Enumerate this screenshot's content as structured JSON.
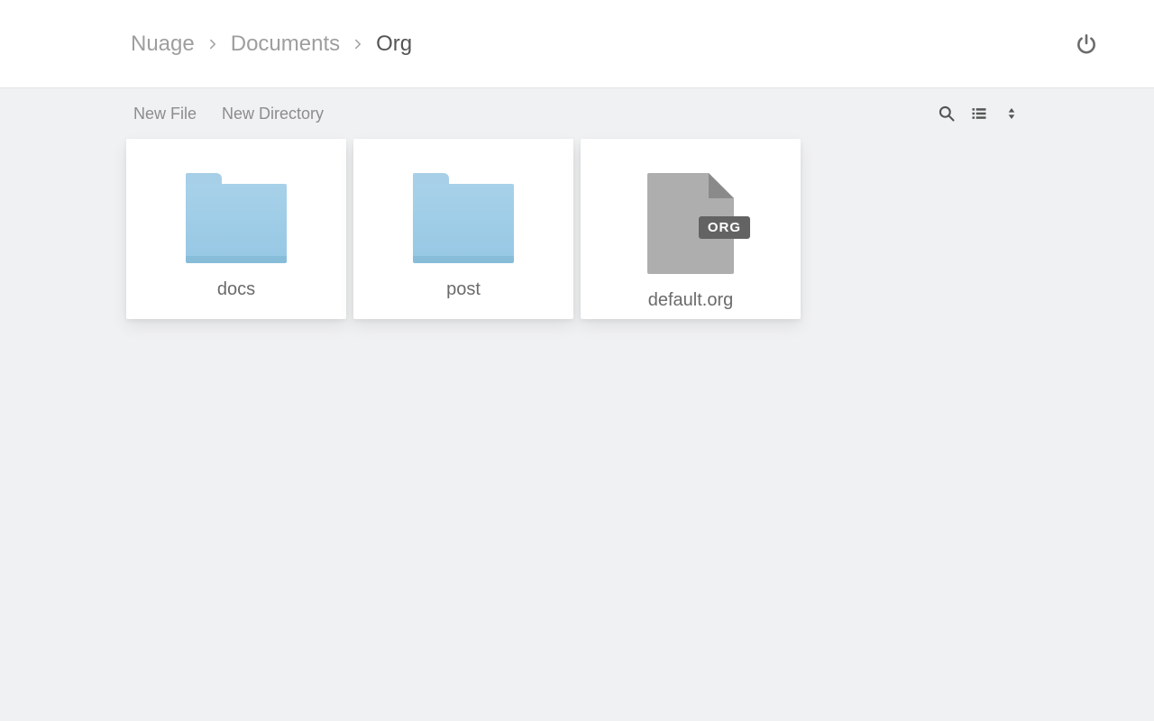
{
  "breadcrumb": {
    "items": [
      {
        "label": "Nuage",
        "current": false
      },
      {
        "label": "Documents",
        "current": false
      },
      {
        "label": "Org",
        "current": true
      }
    ]
  },
  "toolbar": {
    "new_file": "New File",
    "new_directory": "New Directory"
  },
  "items": [
    {
      "type": "folder",
      "label": "docs"
    },
    {
      "type": "folder",
      "label": "post"
    },
    {
      "type": "file",
      "label": "default.org",
      "ext_badge": "ORG"
    }
  ]
}
